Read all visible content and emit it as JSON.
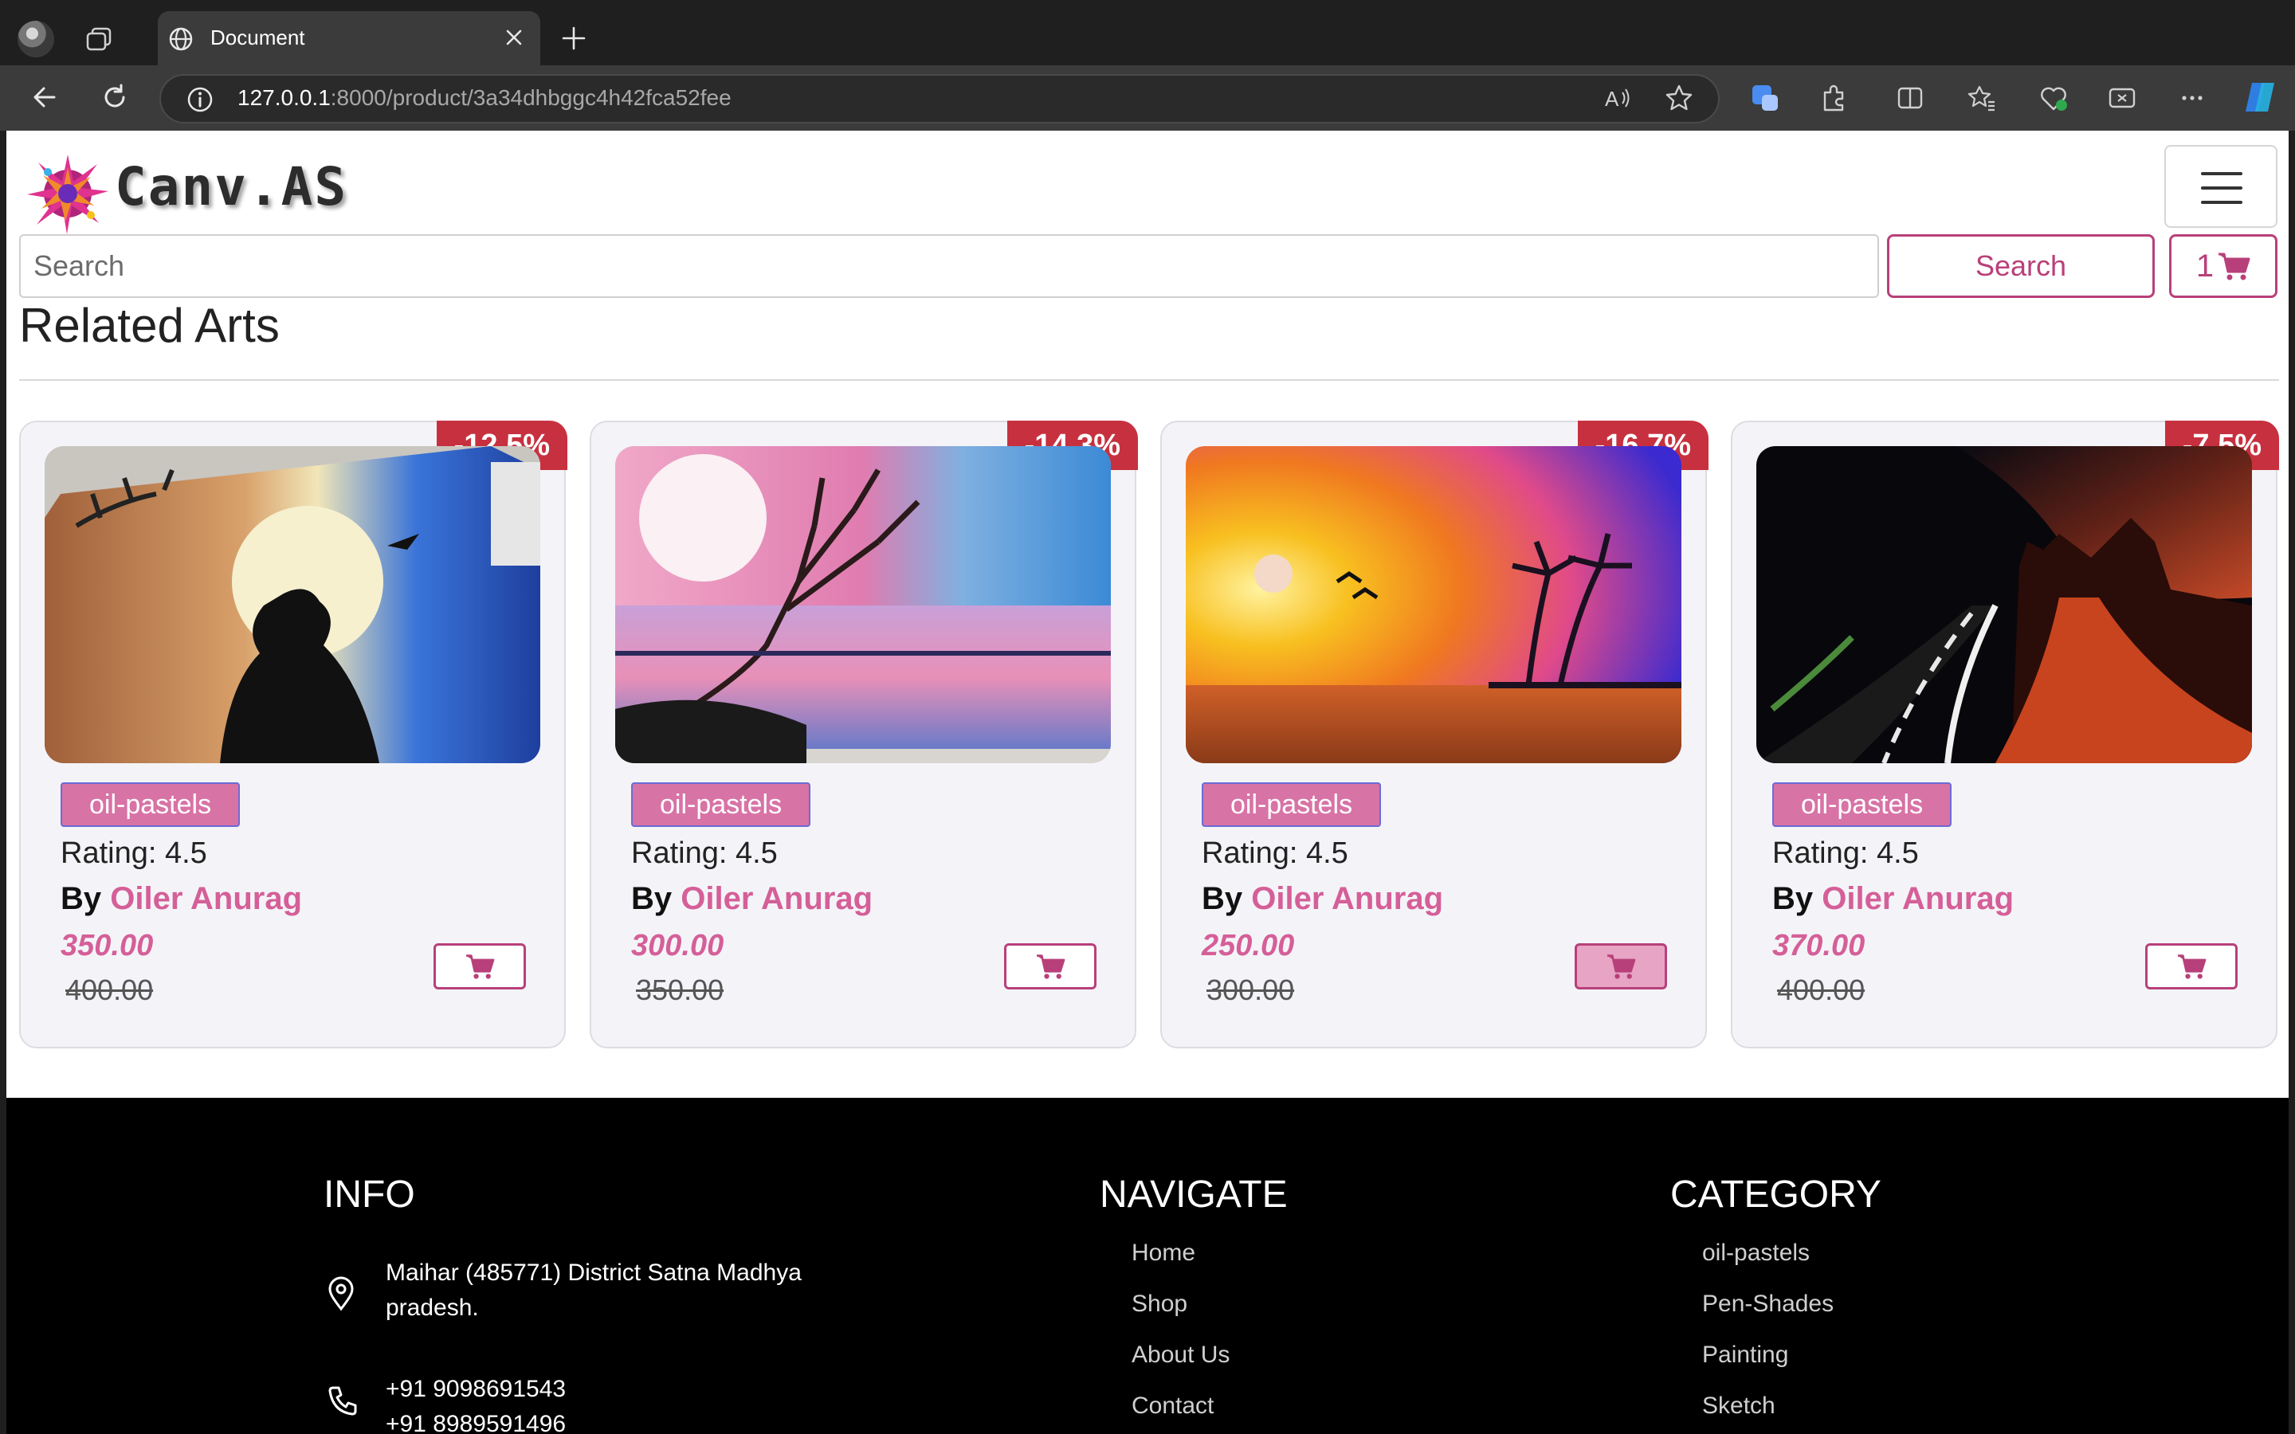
{
  "browser": {
    "tab_title": "Document",
    "url_host": "127.0.0.1",
    "url_rest": ":8000/product/3a34dhbggc4h42fca52fee"
  },
  "site": {
    "logo_text": "Canv.AS",
    "search_placeholder": "Search",
    "search_button": "Search",
    "cart_count": "1"
  },
  "section": {
    "title": "Related Arts"
  },
  "products": [
    {
      "discount": "-12.5%",
      "tag": "oil-pastels",
      "rating": "Rating: 4.5",
      "by": "By",
      "artist": "Oiler Anurag",
      "price": "350.00",
      "old_price": "400.00"
    },
    {
      "discount": "-14.3%",
      "tag": "oil-pastels",
      "rating": "Rating: 4.5",
      "by": "By",
      "artist": "Oiler Anurag",
      "price": "300.00",
      "old_price": "350.00"
    },
    {
      "discount": "-16.7%",
      "tag": "oil-pastels",
      "rating": "Rating: 4.5",
      "by": "By",
      "artist": "Oiler Anurag",
      "price": "250.00",
      "old_price": "300.00"
    },
    {
      "discount": "-7.5%",
      "tag": "oil-pastels",
      "rating": "Rating: 4.5",
      "by": "By",
      "artist": "Oiler Anurag",
      "price": "370.00",
      "old_price": "400.00"
    }
  ],
  "footer": {
    "info": {
      "heading": "INFO",
      "address_line1": "Maihar (485771) District Satna Madhya",
      "address_line2": "pradesh.",
      "phone1": "+91 9098691543",
      "phone2": "+91 8989591496"
    },
    "navigate": {
      "heading": "NAVIGATE",
      "links": [
        "Home",
        "Shop",
        "About Us",
        "Contact"
      ]
    },
    "category": {
      "heading": "CATEGORY",
      "links": [
        "oil-pastels",
        "Pen-Shades",
        "Painting",
        "Sketch"
      ]
    }
  }
}
